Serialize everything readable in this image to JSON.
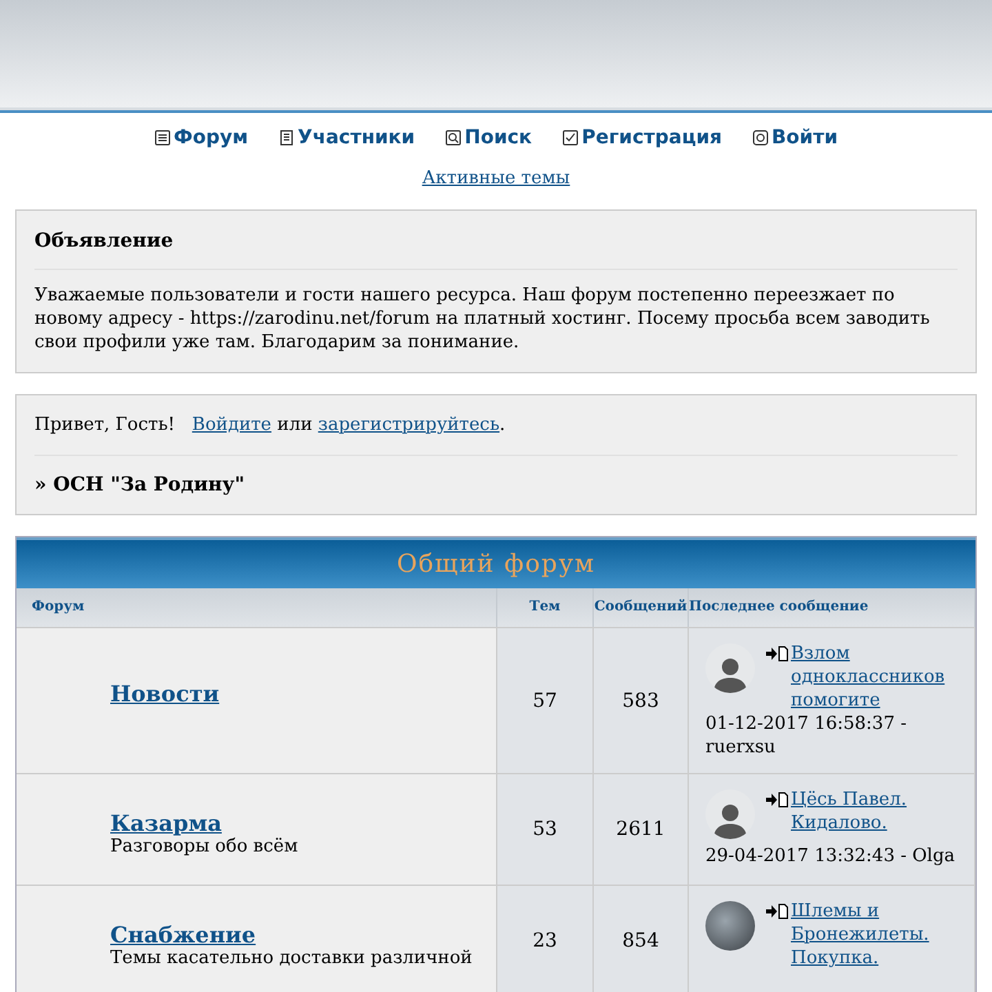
{
  "nav": [
    {
      "label": "Форум"
    },
    {
      "label": "Участники"
    },
    {
      "label": "Поиск"
    },
    {
      "label": "Регистрация"
    },
    {
      "label": "Войти"
    }
  ],
  "active_topics": "Активные темы",
  "announcement": {
    "title": "Объявление",
    "text": "Уважаемые пользователи и гости нашего ресурса. Наш форум постепенно переезжает по новому адресу - https://zarodinu.net/forum на платный хостинг. Посему просьба всем заводить свои профили уже там. Благодарим за понимание."
  },
  "greeting": {
    "text": "Привет, Гость!",
    "login_link": "Войдите",
    "or": "или",
    "register_link": "зарегистрируйтесь",
    "end": ".",
    "breadcrumb": "» ОСН \"За Родину\""
  },
  "forum_table": {
    "title": "Общий форум",
    "columns": [
      "Форум",
      "Тем",
      "Сообщений",
      "Последнее сообщение"
    ],
    "rows": [
      {
        "name": "Новости",
        "topics": "57",
        "posts": "583",
        "last_post": {
          "avatar": {
            "kind": "silhouette"
          },
          "title": "Взлом одноклассников помогите",
          "date": "01-12-2017 16:58:37 - ruerxsu"
        }
      },
      {
        "name": "Казарма",
        "description": "Разговоры обо всём",
        "topics": "53",
        "posts": "2611",
        "last_post": {
          "avatar": {
            "kind": "silhouette"
          },
          "title": "Цёсь Павел. Кидалово.",
          "date": "29-04-2017 13:32:43 - Olga"
        }
      },
      {
        "name": "Снабжение",
        "description": "Темы касательно доставки различной",
        "topics": "23",
        "posts": "854",
        "last_post": {
          "avatar": {
            "kind": "photo"
          },
          "title": "Шлемы и Бронежилеты. Покупка."
        }
      }
    ]
  }
}
